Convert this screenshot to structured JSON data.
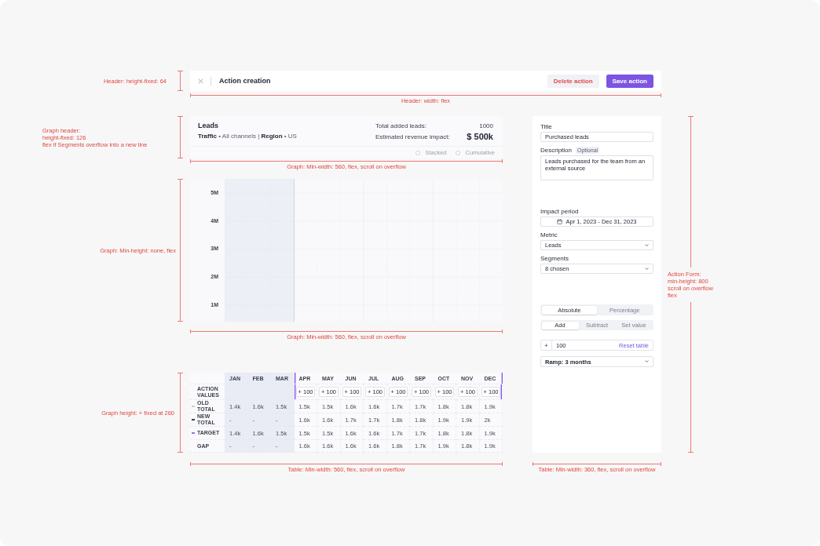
{
  "header": {
    "title": "Action creation",
    "buttons": [
      {
        "label": "Delete action",
        "kind": "secondary"
      },
      {
        "label": "Save action",
        "kind": "primary"
      }
    ]
  },
  "graph_header": {
    "title": "Leads",
    "segments": "**Traffic** • All channels | **Region** • US",
    "stats": [
      {
        "label": "Total added leads:",
        "value": "1000",
        "kind": "plain"
      },
      {
        "label": "Estimated revenue impact:",
        "value": "$ 500k",
        "kind": "highlight"
      }
    ],
    "options": [
      {
        "label": "Stacked",
        "checked": false
      },
      {
        "label": "Cumulative",
        "checked": false
      }
    ]
  },
  "graph": {
    "y_axis_labels": [
      "5M",
      "4M",
      "3M",
      "2M",
      "1M"
    ]
  },
  "table": {
    "columns": [
      {
        "label": "JAN",
        "past": true
      },
      {
        "label": "FEB",
        "past": true
      },
      {
        "label": "MAR",
        "past": true
      },
      {
        "label": "APR",
        "past": false
      },
      {
        "label": "MAY",
        "past": false
      },
      {
        "label": "JUN",
        "past": false
      },
      {
        "label": "JUL",
        "past": false
      },
      {
        "label": "AUG",
        "past": false
      },
      {
        "label": "SEP",
        "past": false
      },
      {
        "label": "OCT",
        "past": false
      },
      {
        "label": "NOV",
        "past": false
      },
      {
        "label": "DEC",
        "past": false
      }
    ],
    "rows": [
      {
        "label": "ACTION VALUES",
        "kind": "input",
        "inputs": [
          {
            "sign": "+",
            "value": "100"
          },
          {
            "sign": "+",
            "value": "100"
          },
          {
            "sign": "+",
            "value": "100"
          },
          {
            "sign": "+",
            "value": "100"
          },
          {
            "sign": "+",
            "value": "100"
          },
          {
            "sign": "+",
            "value": "100"
          },
          {
            "sign": "+",
            "value": "100"
          },
          {
            "sign": "+",
            "value": "100"
          },
          {
            "sign": "+",
            "value": "100"
          }
        ]
      },
      {
        "label": "OLD TOTAL",
        "kind": "data",
        "color": "#c8cad2",
        "cells": [
          "1.4k",
          "1.6k",
          "1.5k",
          "1.5k",
          "1.5k",
          "1.6k",
          "1.6k",
          "1.7k",
          "1.7k",
          "1.8k",
          "1.8k",
          "1.9k"
        ]
      },
      {
        "label": "NEW TOTAL",
        "kind": "data",
        "color": "#3a3f4c",
        "cells": [
          "-",
          "-",
          "-",
          "1.6k",
          "1.6k",
          "1.7k",
          "1.7k",
          "1.8k",
          "1.8k",
          "1.9k",
          "1.9k",
          "2k"
        ]
      },
      {
        "label": "TARGET",
        "kind": "data",
        "color": "#9b6df0",
        "cells": [
          "1.4k",
          "1.6k",
          "1.5k",
          "1.5k",
          "1.5k",
          "1.6k",
          "1.6k",
          "1.7k",
          "1.7k",
          "1.8k",
          "1.8k",
          "1.9k"
        ]
      },
      {
        "label": "GAP",
        "kind": "data",
        "cells": [
          "-",
          "-",
          "-",
          "1.6k",
          "1.6k",
          "1.6k",
          "1.6k",
          "1.8k",
          "1.7k",
          "1.9k",
          "1.8k",
          "1.9k"
        ]
      }
    ]
  },
  "action_form": {
    "fields": [
      {
        "kind": "text",
        "label": "Title",
        "value": "Purchased leads"
      },
      {
        "kind": "textarea",
        "label": "Description",
        "badge": "Optional",
        "value": "Leads purchased for the team from an external source"
      },
      {
        "kind": "date",
        "label": "Impact period",
        "value": "Apr 1, 2023 - Dec 31, 2023"
      },
      {
        "kind": "select",
        "label": "Metric",
        "value": "Leads"
      },
      {
        "kind": "select",
        "label": "Segments",
        "value": "8 chosen"
      }
    ],
    "value_type": [
      {
        "label": "Absolute",
        "selected": true
      },
      {
        "label": "Percentage",
        "selected": false
      }
    ],
    "operation": [
      {
        "label": "Add",
        "selected": true
      },
      {
        "label": "Subtract",
        "selected": false
      },
      {
        "label": "Set value",
        "selected": false
      }
    ],
    "amount": {
      "sign": "+",
      "value": "100",
      "link": "Reset table"
    },
    "ramp": {
      "value": "Ramp: 3 months"
    }
  },
  "spec_annotations": {
    "header_height": [
      "Header: height-fixed: 64"
    ],
    "header_width": "Header: width: flex",
    "graph_header_height": [
      "Graph header:",
      "height-fixed: 126",
      "flex if Segments overflow into a new line"
    ],
    "graph_header_width": "Graph: Min-width: 560, flex, scroll on overflow",
    "graph_height": [
      "Graph: Min-height: none, flex"
    ],
    "graph_width": "Graph: Min-width: 560, flex, scroll on overflow",
    "table_height": [
      "Graph height: + fixed at 260"
    ],
    "table_width": "Table: Min-width: 560, flex, scroll on overflow",
    "form_height": [
      "Action Form:",
      "min-height: 800",
      "scroll on overflow",
      "flex"
    ],
    "form_width": "Table: Min-width: 360, flex, scroll on overflow"
  }
}
